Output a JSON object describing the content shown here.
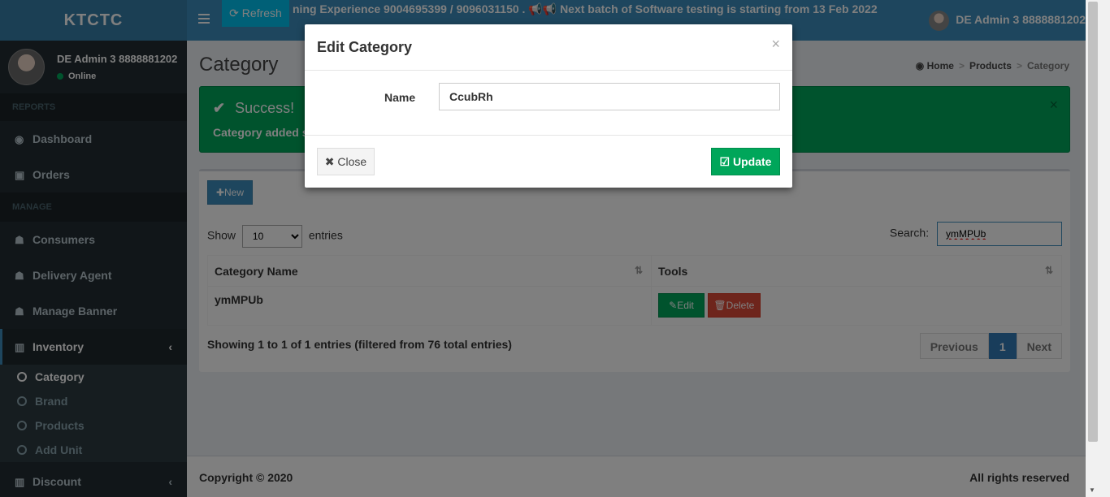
{
  "sidebar": {
    "logo": "KTCTC",
    "user_name": "DE Admin 3 8888881202",
    "user_status": "Online",
    "section_reports": "REPORTS",
    "section_manage": "MANAGE",
    "items": {
      "dashboard": "Dashboard",
      "orders": "Orders",
      "consumers": "Consumers",
      "delivery_agent": "Delivery Agent",
      "manage_banner": "Manage Banner",
      "inventory": "Inventory",
      "discount": "Discount"
    },
    "inventory_sub": {
      "category": "Category",
      "brand": "Brand",
      "products": "Products",
      "add_unit": "Add Unit"
    }
  },
  "topbar": {
    "refresh_label": "Refresh",
    "marquee": "ning Experience 9004695399 / 9096031150 . 📢📢 Next batch of Software testing is starting from 13 Feb 2022",
    "user": "DE Admin 3 8888881202"
  },
  "page": {
    "title": "Category",
    "breadcrumb": [
      "Home",
      "Products",
      "Category"
    ]
  },
  "alert": {
    "title": "Success!",
    "message": "Category added su"
  },
  "table_controls": {
    "new_label": "New",
    "show_label": "Show",
    "entries_label": "entries",
    "page_length": "10",
    "search_label": "Search:",
    "search_value": "ymMPUb"
  },
  "table": {
    "headers": [
      "Category Name",
      "Tools"
    ],
    "rows": [
      {
        "name": "ymMPUb",
        "edit": "Edit",
        "delete": "Delete"
      }
    ]
  },
  "pagination": {
    "info": "Showing 1 to 1 of 1 entries (filtered from 76 total entries)",
    "previous": "Previous",
    "current": "1",
    "next": "Next"
  },
  "footer": {
    "copyright": "Copyright © 2020",
    "rights": "All rights reserved"
  },
  "modal": {
    "title": "Edit Category",
    "close_x": "×",
    "name_label": "Name",
    "name_value": "CcubRh",
    "close_label": "Close",
    "update_label": "Update"
  }
}
